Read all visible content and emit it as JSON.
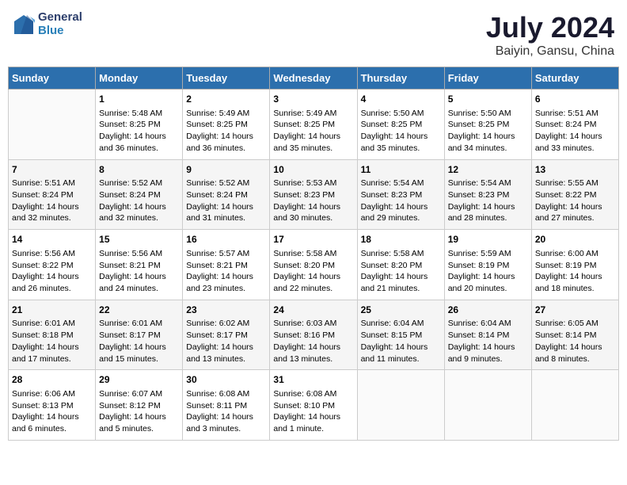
{
  "header": {
    "logo_line1": "General",
    "logo_line2": "Blue",
    "title": "July 2024",
    "subtitle": "Baiyin, Gansu, China"
  },
  "days_of_week": [
    "Sunday",
    "Monday",
    "Tuesday",
    "Wednesday",
    "Thursday",
    "Friday",
    "Saturday"
  ],
  "weeks": [
    {
      "cells": [
        {
          "day": null,
          "content": ""
        },
        {
          "day": "1",
          "content": "Sunrise: 5:48 AM\nSunset: 8:25 PM\nDaylight: 14 hours\nand 36 minutes."
        },
        {
          "day": "2",
          "content": "Sunrise: 5:49 AM\nSunset: 8:25 PM\nDaylight: 14 hours\nand 36 minutes."
        },
        {
          "day": "3",
          "content": "Sunrise: 5:49 AM\nSunset: 8:25 PM\nDaylight: 14 hours\nand 35 minutes."
        },
        {
          "day": "4",
          "content": "Sunrise: 5:50 AM\nSunset: 8:25 PM\nDaylight: 14 hours\nand 35 minutes."
        },
        {
          "day": "5",
          "content": "Sunrise: 5:50 AM\nSunset: 8:25 PM\nDaylight: 14 hours\nand 34 minutes."
        },
        {
          "day": "6",
          "content": "Sunrise: 5:51 AM\nSunset: 8:24 PM\nDaylight: 14 hours\nand 33 minutes."
        }
      ]
    },
    {
      "cells": [
        {
          "day": "7",
          "content": "Sunrise: 5:51 AM\nSunset: 8:24 PM\nDaylight: 14 hours\nand 32 minutes."
        },
        {
          "day": "8",
          "content": "Sunrise: 5:52 AM\nSunset: 8:24 PM\nDaylight: 14 hours\nand 32 minutes."
        },
        {
          "day": "9",
          "content": "Sunrise: 5:52 AM\nSunset: 8:24 PM\nDaylight: 14 hours\nand 31 minutes."
        },
        {
          "day": "10",
          "content": "Sunrise: 5:53 AM\nSunset: 8:23 PM\nDaylight: 14 hours\nand 30 minutes."
        },
        {
          "day": "11",
          "content": "Sunrise: 5:54 AM\nSunset: 8:23 PM\nDaylight: 14 hours\nand 29 minutes."
        },
        {
          "day": "12",
          "content": "Sunrise: 5:54 AM\nSunset: 8:23 PM\nDaylight: 14 hours\nand 28 minutes."
        },
        {
          "day": "13",
          "content": "Sunrise: 5:55 AM\nSunset: 8:22 PM\nDaylight: 14 hours\nand 27 minutes."
        }
      ]
    },
    {
      "cells": [
        {
          "day": "14",
          "content": "Sunrise: 5:56 AM\nSunset: 8:22 PM\nDaylight: 14 hours\nand 26 minutes."
        },
        {
          "day": "15",
          "content": "Sunrise: 5:56 AM\nSunset: 8:21 PM\nDaylight: 14 hours\nand 24 minutes."
        },
        {
          "day": "16",
          "content": "Sunrise: 5:57 AM\nSunset: 8:21 PM\nDaylight: 14 hours\nand 23 minutes."
        },
        {
          "day": "17",
          "content": "Sunrise: 5:58 AM\nSunset: 8:20 PM\nDaylight: 14 hours\nand 22 minutes."
        },
        {
          "day": "18",
          "content": "Sunrise: 5:58 AM\nSunset: 8:20 PM\nDaylight: 14 hours\nand 21 minutes."
        },
        {
          "day": "19",
          "content": "Sunrise: 5:59 AM\nSunset: 8:19 PM\nDaylight: 14 hours\nand 20 minutes."
        },
        {
          "day": "20",
          "content": "Sunrise: 6:00 AM\nSunset: 8:19 PM\nDaylight: 14 hours\nand 18 minutes."
        }
      ]
    },
    {
      "cells": [
        {
          "day": "21",
          "content": "Sunrise: 6:01 AM\nSunset: 8:18 PM\nDaylight: 14 hours\nand 17 minutes."
        },
        {
          "day": "22",
          "content": "Sunrise: 6:01 AM\nSunset: 8:17 PM\nDaylight: 14 hours\nand 15 minutes."
        },
        {
          "day": "23",
          "content": "Sunrise: 6:02 AM\nSunset: 8:17 PM\nDaylight: 14 hours\nand 13 minutes."
        },
        {
          "day": "24",
          "content": "Sunrise: 6:03 AM\nSunset: 8:16 PM\nDaylight: 14 hours\nand 13 minutes."
        },
        {
          "day": "25",
          "content": "Sunrise: 6:04 AM\nSunset: 8:15 PM\nDaylight: 14 hours\nand 11 minutes."
        },
        {
          "day": "26",
          "content": "Sunrise: 6:04 AM\nSunset: 8:14 PM\nDaylight: 14 hours\nand 9 minutes."
        },
        {
          "day": "27",
          "content": "Sunrise: 6:05 AM\nSunset: 8:14 PM\nDaylight: 14 hours\nand 8 minutes."
        }
      ]
    },
    {
      "cells": [
        {
          "day": "28",
          "content": "Sunrise: 6:06 AM\nSunset: 8:13 PM\nDaylight: 14 hours\nand 6 minutes."
        },
        {
          "day": "29",
          "content": "Sunrise: 6:07 AM\nSunset: 8:12 PM\nDaylight: 14 hours\nand 5 minutes."
        },
        {
          "day": "30",
          "content": "Sunrise: 6:08 AM\nSunset: 8:11 PM\nDaylight: 14 hours\nand 3 minutes."
        },
        {
          "day": "31",
          "content": "Sunrise: 6:08 AM\nSunset: 8:10 PM\nDaylight: 14 hours\nand 1 minute."
        },
        {
          "day": null,
          "content": ""
        },
        {
          "day": null,
          "content": ""
        },
        {
          "day": null,
          "content": ""
        }
      ]
    }
  ]
}
